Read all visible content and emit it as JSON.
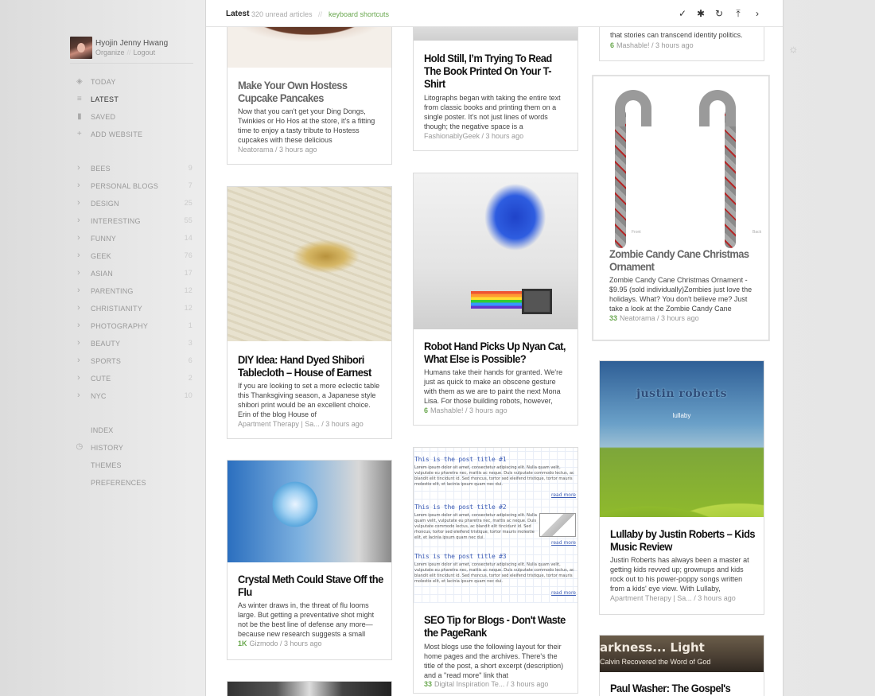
{
  "user": {
    "name": "Hyojin Jenny Hwang",
    "organize": "Organize",
    "sep": "//",
    "logout": "Logout"
  },
  "nav": [
    {
      "icon": "today-icon",
      "label": "TODAY"
    },
    {
      "icon": "list-icon",
      "label": "LATEST"
    },
    {
      "icon": "bookmark-icon",
      "label": "SAVED"
    },
    {
      "icon": "plus-icon",
      "label": "ADD WEBSITE"
    }
  ],
  "categories": [
    {
      "label": "BEES",
      "count": "9"
    },
    {
      "label": "PERSONAL BLOGS",
      "count": "7"
    },
    {
      "label": "DESIGN",
      "count": "25"
    },
    {
      "label": "INTERESTING",
      "count": "55"
    },
    {
      "label": "FUNNY",
      "count": "14"
    },
    {
      "label": "GEEK",
      "count": "76"
    },
    {
      "label": "ASIAN",
      "count": "17"
    },
    {
      "label": "PARENTING",
      "count": "12"
    },
    {
      "label": "CHRISTIANITY",
      "count": "12"
    },
    {
      "label": "PHOTOGRAPHY",
      "count": "1"
    },
    {
      "label": "BEAUTY",
      "count": "3"
    },
    {
      "label": "SPORTS",
      "count": "6"
    },
    {
      "label": "CUTE",
      "count": "2"
    },
    {
      "label": "NYC",
      "count": "10"
    }
  ],
  "footer_nav": [
    {
      "label": "INDEX",
      "icon": ""
    },
    {
      "label": "HISTORY",
      "icon": "clock-icon"
    },
    {
      "label": "THEMES",
      "icon": ""
    },
    {
      "label": "PREFERENCES",
      "icon": ""
    }
  ],
  "topbar": {
    "title": "Latest",
    "unread": "320 unread articles",
    "sep": "//",
    "shortcuts": "keyboard shortcuts",
    "buttons": [
      "check-icon",
      "gear-icon",
      "refresh-icon",
      "to-top-icon",
      "next-icon"
    ]
  },
  "articles": {
    "hostess": {
      "title": "Make Your Own Hostess Cupcake Pancakes",
      "excerpt": "Now that you can't get your Ding Dongs, Twinkies or Ho Hos at the store, it's a fitting time to enjoy a tasty tribute to Hostess cupcakes with these delicious",
      "meta": "Neatorama / 3 hours ago"
    },
    "holdstill": {
      "title": "Hold Still, I’m Trying To Read The Book Printed On Your T-Shirt",
      "excerpt": "Litographs began with taking the entire text from classic books and printing them on a single poster. It's not just lines of words though; the negative space is a",
      "meta": "FashionablyGeek / 3 hours ago"
    },
    "identity": {
      "excerpt": "that stories can transcend identity politics.",
      "engagement": "6",
      "meta": "Mashable! / 3 hours ago"
    },
    "shibori": {
      "title": "DIY Idea: Hand Dyed Shibori Tablecloth – House of Earnest",
      "excerpt": "If you are looking to set a more eclectic table this Thanksgiving season, a Japanese style shibori print would be an excellent choice. Erin of the blog House of",
      "meta": "Apartment Therapy | Sa... / 3 hours ago"
    },
    "nyancat": {
      "title": "Robot Hand Picks Up Nyan Cat, What Else is Possible?",
      "excerpt": "Humans take their hands for granted. We're just as quick to make an obscene gesture with them as we are to paint the next Mona Lisa. For those building robots, however,",
      "engagement": "6",
      "meta": "Mashable! / 3 hours ago"
    },
    "candycane": {
      "title": "Zombie Candy Cane Christmas Ornament",
      "excerpt": "Zombie Candy Cane Christmas Ornament - $9.95 (sold individually)Zombies just love the holidays. What? You don't believe me? Just take a look at the Zombie Candy Cane",
      "engagement": "33",
      "meta": "Neatorama / 3 hours ago",
      "caption_front": "Front",
      "caption_back": "Back"
    },
    "meth": {
      "title": "Crystal Meth Could Stave Off the Flu",
      "excerpt": "As winter draws in, the threat of flu looms large. But getting a preventative shot might not be the best line of defense any more—because new research suggests a small",
      "engagement": "1K",
      "meta": "Gizmodo / 3 hours ago"
    },
    "seo": {
      "title": "SEO Tip for Blogs - Don't Waste the PageRank",
      "excerpt": "Most blogs use the following layout for their home pages and the archives. There's the title of the post, a short excerpt (description) and a \"read more\" link that",
      "engagement": "33",
      "meta": "Digital Inspiration Te... / 3 hours ago",
      "img_titles": [
        "This is the post title #1",
        "This is the post title #2",
        "This is the post title #3"
      ],
      "img_lorem": "Lorem ipsum dolor sit amet, consectetur adipiscing elit. Nulla quam velit, vulputate eu pharetra nec, mattis ac neque. Duis vulputate commodo lectus, ac blandit elit tincidunt id. Sed rhoncus, tortor sed eleifend tristique, tortor mauris molestie elit, et lacinia ipsum quam nec dui.",
      "img_readmore": "read more"
    },
    "lullaby": {
      "title": "Lullaby by Justin Roberts – Kids Music Review",
      "excerpt": "Justin Roberts has always been a master at getting kids revved up; grownups and kids rock out to his power-poppy songs written from a kids' eye view. With Lullaby,",
      "meta": "Apartment Therapy | Sa... / 3 hours ago",
      "album_title": "justin roberts",
      "album_sub": "lullaby"
    },
    "washer": {
      "title": "Paul Washer: The Gospel's",
      "img_title": "arkness... Light",
      "img_sub": "Calvin Recovered the Word of God"
    }
  }
}
